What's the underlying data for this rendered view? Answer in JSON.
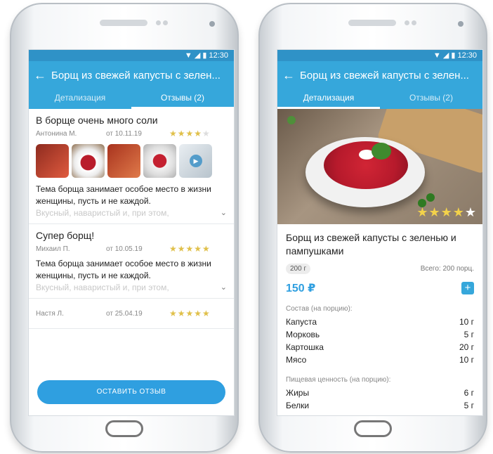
{
  "left_phone": {
    "status_time": "12:30",
    "title": "Борщ из свежей капусты с зелен...",
    "tabs": [
      "Детализация",
      "Отзывы (2)"
    ],
    "reviews": [
      {
        "title": "В борще очень много соли",
        "author": "Антонина М.",
        "date": "от 10.11.19",
        "rating": 4,
        "text": "Тема борща занимает особое место в жизни женщины, пусть и не каждой.",
        "fade": "Вкусный, наваристый и, при этом,"
      },
      {
        "title": "Супер борщ!",
        "author": "Михаил П.",
        "date": "от 10.05.19",
        "rating": 5,
        "text": "Тема борща занимает особое место в жизни женщины, пусть и не каждой.",
        "fade": "Вкусный, наваристый и, при этом,"
      },
      {
        "author": "Настя Л.",
        "date": "от 25.04.19",
        "rating": 5
      }
    ],
    "leave_review": "ОСТАВИТЬ ОТЗЫВ"
  },
  "right_phone": {
    "status_time": "12:30",
    "title": "Борщ из свежей капусты с зелен...",
    "tabs": [
      "Детализация",
      "Отзывы (2)"
    ],
    "hero_rating": 4,
    "dish_name": "Борщ из свежей капусты с зеленью и пампушками",
    "weight": "200 г",
    "total": "Всего: 200 порц.",
    "price": "150 ₽",
    "composition_label": "Состав (на порцию):",
    "ingredients": [
      {
        "name": "Капуста",
        "amount": "10 г"
      },
      {
        "name": "Морковь",
        "amount": "5 г"
      },
      {
        "name": "Картошка",
        "amount": "20 г"
      },
      {
        "name": "Мясо",
        "amount": "10 г"
      }
    ],
    "nutrition_label": "Пищевая ценность (на порцию):",
    "nutrition": [
      {
        "name": "Жиры",
        "amount": "6 г"
      },
      {
        "name": "Белки",
        "amount": "5 г"
      }
    ]
  },
  "colors": {
    "primary": "#36a7db",
    "status_bar": "#2f92c7",
    "button": "#2f9fe0",
    "star": "#e0c04a"
  },
  "icons": [
    "back-arrow-icon",
    "play-icon",
    "chevron-down-icon",
    "plus-icon",
    "star-icon"
  ]
}
